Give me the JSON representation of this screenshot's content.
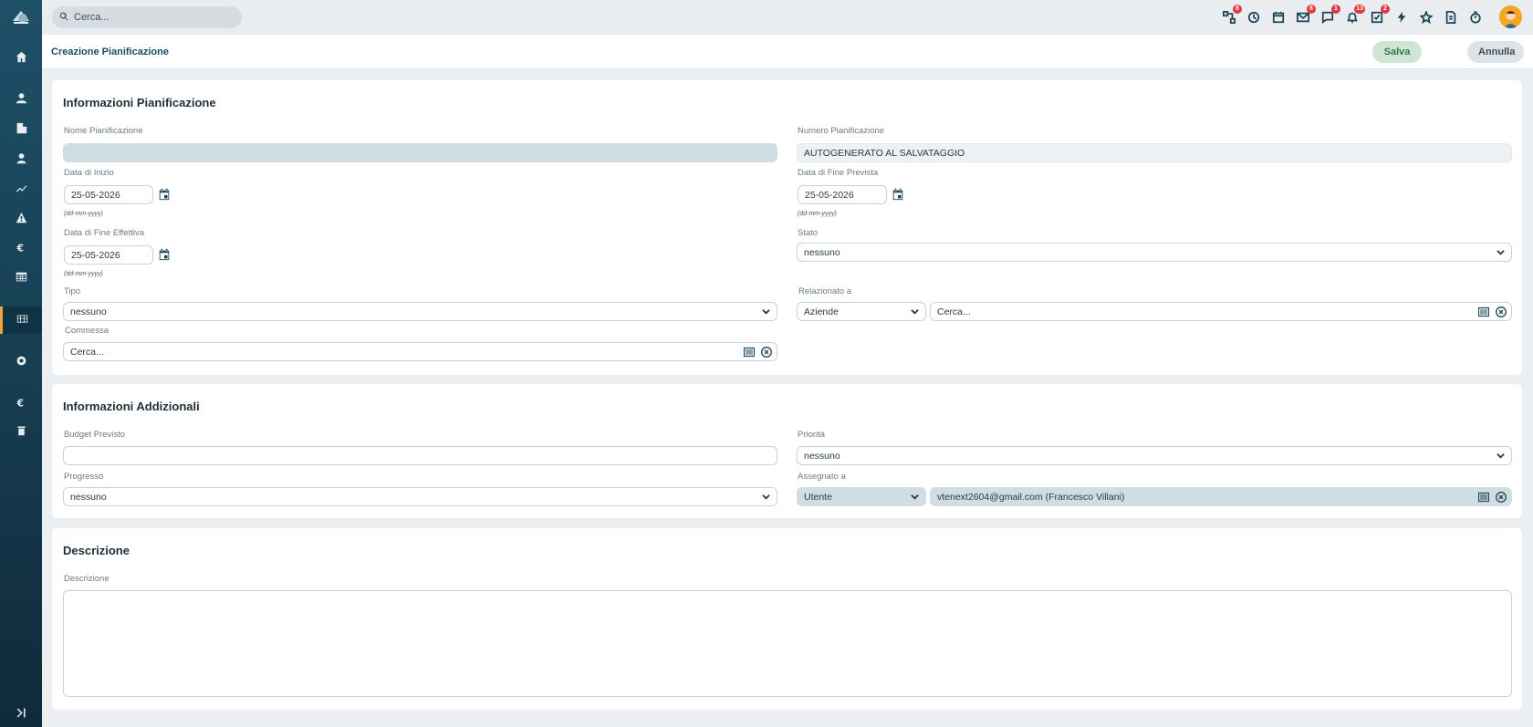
{
  "topbar": {
    "search_placeholder": "Cerca...",
    "icons": [
      {
        "name": "process-icon",
        "badge": "8"
      },
      {
        "name": "history-icon",
        "badge": ""
      },
      {
        "name": "calendar-icon",
        "badge": ""
      },
      {
        "name": "mail-icon",
        "badge": "8"
      },
      {
        "name": "chat-icon",
        "badge": "1"
      },
      {
        "name": "bell-icon",
        "badge": "13"
      },
      {
        "name": "tasks-icon",
        "badge": "2"
      },
      {
        "name": "bolt-icon",
        "badge": ""
      },
      {
        "name": "star-icon",
        "badge": ""
      },
      {
        "name": "document-icon",
        "badge": ""
      },
      {
        "name": "timer-icon",
        "badge": ""
      }
    ]
  },
  "header": {
    "title": "Creazione Pianificazione",
    "save_label": "Salva",
    "cancel_label": "Annulla"
  },
  "section1": {
    "title": "Informazioni Pianificazione",
    "nome_label": "Nome Pianificazione",
    "nome_value": "",
    "numero_label": "Numero Pianificazione",
    "numero_value": "AUTOGENERATO AL SALVATAGGIO",
    "data_inizio_label": "Data di Inizio",
    "data_inizio_value": "25-05-2026",
    "data_fine_prevista_label": "Data di Fine Prevista",
    "data_fine_prevista_value": "25-05-2026",
    "date_format_hint": "(dd-mm-yyyy)",
    "data_fine_effettiva_label": "Data di Fine Effettiva",
    "data_fine_effettiva_value": "25-05-2026",
    "stato_label": "Stato",
    "stato_value": "nessuno",
    "tipo_label": "Tipo",
    "tipo_value": "nessuno",
    "relazionato_label": "Relazionato a",
    "relazionato_module": "Aziende",
    "relazionato_placeholder": "Cerca...",
    "commessa_label": "Commessa",
    "commessa_placeholder": "Cerca..."
  },
  "section2": {
    "title": "Informazioni Addizionali",
    "budget_label": "Budget Previsto",
    "budget_value": "",
    "priorita_label": "Priorità",
    "priorita_value": "nessuno",
    "progresso_label": "Progresso",
    "progresso_value": "nessuno",
    "assegnato_label": "Assegnato a",
    "assegnato_type": "Utente",
    "assegnato_value": "vtenext2604@gmail.com (Francesco Villani)"
  },
  "section3": {
    "title": "Descrizione",
    "descrizione_label": "Descrizione",
    "descrizione_value": ""
  },
  "colors": {
    "sidebar": "#173e52",
    "accent": "#f0a23a",
    "badge": "#e0393e",
    "save_bg": "#cfe6d6"
  }
}
